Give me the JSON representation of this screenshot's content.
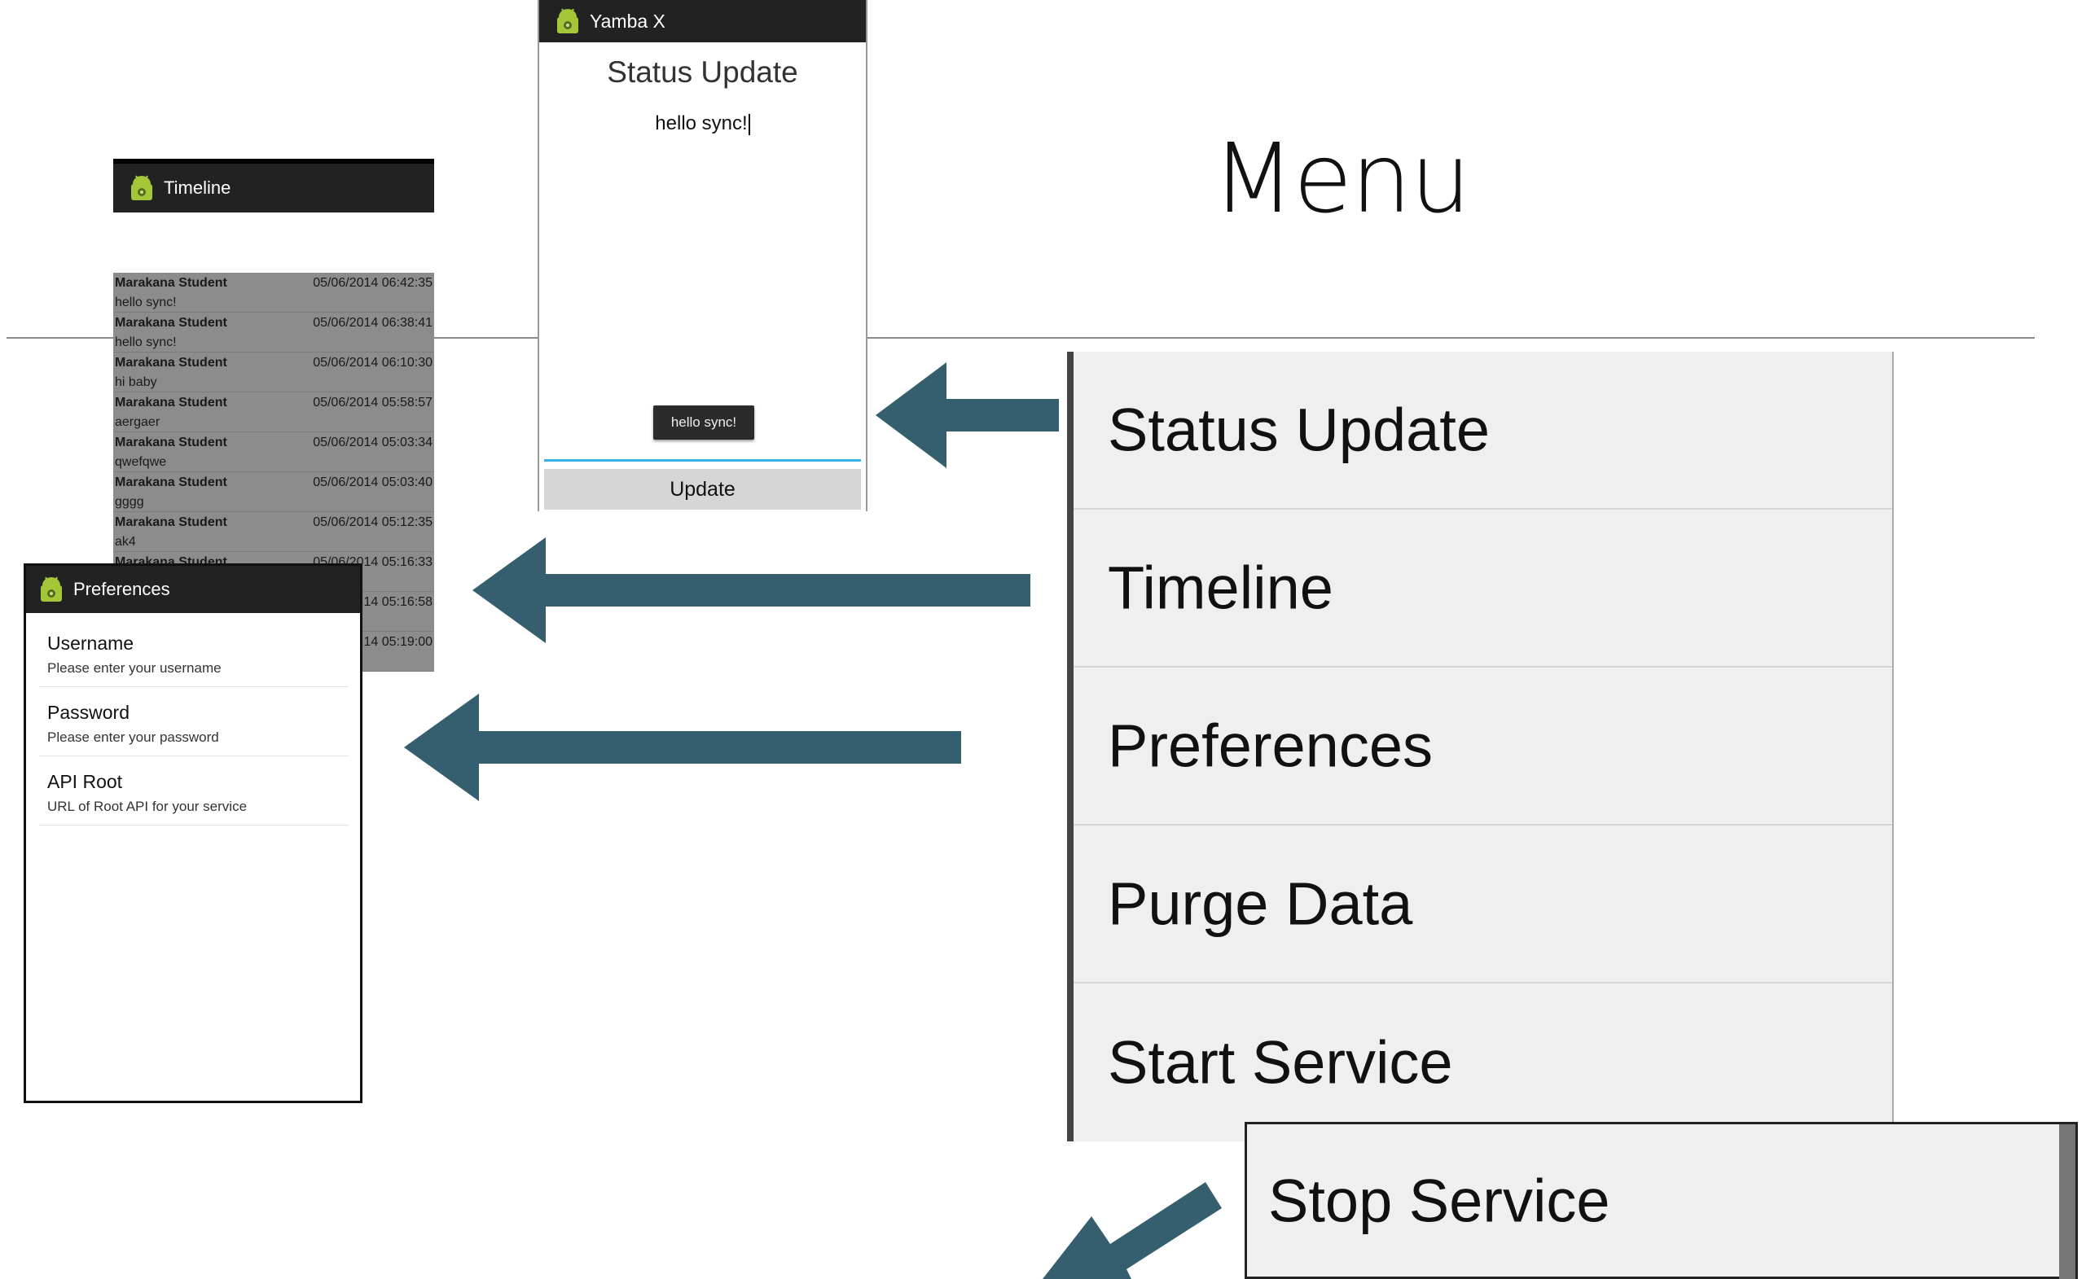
{
  "slide": {
    "title": "Menu"
  },
  "timeline": {
    "title": "Timeline",
    "rows": [
      {
        "user": "Marakana Student",
        "date": "05/06/2014 06:42:35",
        "text": "hello sync!"
      },
      {
        "user": "Marakana Student",
        "date": "05/06/2014 06:38:41",
        "text": "hello sync!"
      },
      {
        "user": "Marakana Student",
        "date": "05/06/2014 06:10:30",
        "text": "hi baby"
      },
      {
        "user": "Marakana Student",
        "date": "05/06/2014 05:58:57",
        "text": "aergaer"
      },
      {
        "user": "Marakana Student",
        "date": "05/06/2014 05:03:34",
        "text": "qwefqwe"
      },
      {
        "user": "Marakana Student",
        "date": "05/06/2014 05:03:40",
        "text": "gggg"
      },
      {
        "user": "Marakana Student",
        "date": "05/06/2014 05:12:35",
        "text": "ak4"
      },
      {
        "user": "Marakana Student",
        "date": "05/06/2014 05:16:33",
        "text": ""
      },
      {
        "user": "",
        "date": "14 05:16:58",
        "text": ""
      },
      {
        "user": "",
        "date": "14 05:19:00",
        "text": ""
      }
    ]
  },
  "status": {
    "app_title": "Yamba X",
    "heading": "Status Update",
    "text": "hello sync!",
    "toast": "hello sync!",
    "button": "Update"
  },
  "preferences": {
    "title": "Preferences",
    "items": [
      {
        "title": "Username",
        "summary": "Please enter your username"
      },
      {
        "title": "Password",
        "summary": "Please enter your password"
      },
      {
        "title": "API Root",
        "summary": "URL of Root API for your service"
      }
    ]
  },
  "menu": {
    "items": [
      "Status Update",
      "Timeline",
      "Preferences",
      "Purge Data",
      "Start Service"
    ],
    "stop_service": "Stop Service"
  },
  "colors": {
    "arrow": "#355e6e",
    "actionbar": "#222222",
    "accent": "#33b5e5"
  },
  "icons": {
    "app": "android-icon"
  }
}
